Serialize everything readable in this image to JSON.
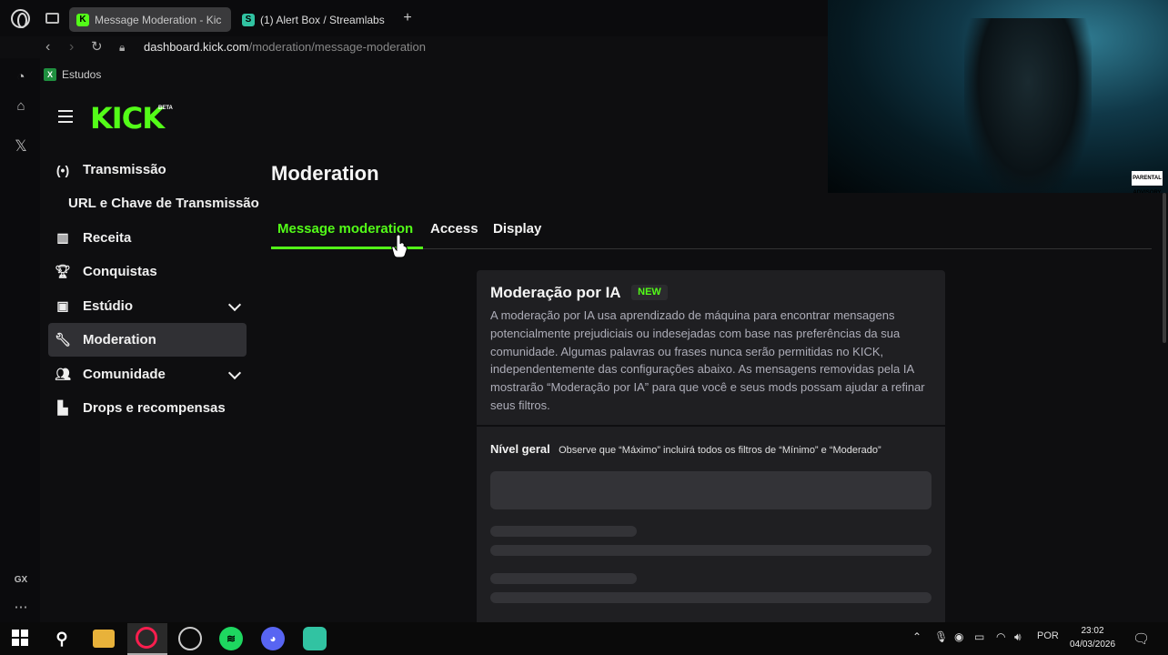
{
  "browser": {
    "tabs": [
      {
        "label": "Message Moderation - Kic",
        "favicon": "K",
        "active": true
      },
      {
        "label": "(1) Alert Box / Streamlabs",
        "favicon": "S",
        "active": false
      }
    ],
    "url_domain": "dashboard.kick.com",
    "url_path": "/moderation/message-moderation",
    "bookmark": "Estudos",
    "rail_bottom_label": "GX"
  },
  "sidebar": {
    "logo": "KICK",
    "beta": "BETA",
    "items": [
      {
        "label": "Transmissão",
        "icon": "broadcast-icon"
      },
      {
        "label": "URL e Chave de Transmissão"
      },
      {
        "label": "Receita",
        "icon": "chart-icon"
      },
      {
        "label": "Conquistas",
        "icon": "trophy-icon"
      },
      {
        "label": "Estúdio",
        "icon": "studio-icon",
        "expandable": true
      },
      {
        "label": "Moderation",
        "icon": "wrench-icon",
        "active": true
      },
      {
        "label": "Comunidade",
        "icon": "community-icon",
        "expandable": true
      },
      {
        "label": "Drops e recompensas",
        "icon": "drops-icon"
      }
    ]
  },
  "main": {
    "title": "Moderation",
    "tabs": [
      "Message moderation",
      "Access",
      "Display"
    ],
    "card": {
      "title": "Moderação por IA",
      "badge": "NEW",
      "description": "A moderação por IA usa aprendizado de máquina para encontrar mensagens potencialmente prejudiciais ou indesejadas com base nas preferências da sua comunidade. Algumas palavras ou frases nunca serão permitidas no KICK, independentemente das configurações abaixo. As mensagens removidas pela IA mostrarão “Moderação por IA” para que você e seus mods possam ajudar a refinar seus filtros.",
      "level_label": "Nível geral",
      "level_note": "Observe que “Máximo” incluirá todos os filtros de “Mínimo” e “Moderado”"
    }
  },
  "taskbar": {
    "language": "POR",
    "time": "23:02",
    "date": "04/03/2026"
  },
  "colors": {
    "kick_green": "#53fc18",
    "background": "#0e0e10",
    "card": "#1f1f22"
  }
}
